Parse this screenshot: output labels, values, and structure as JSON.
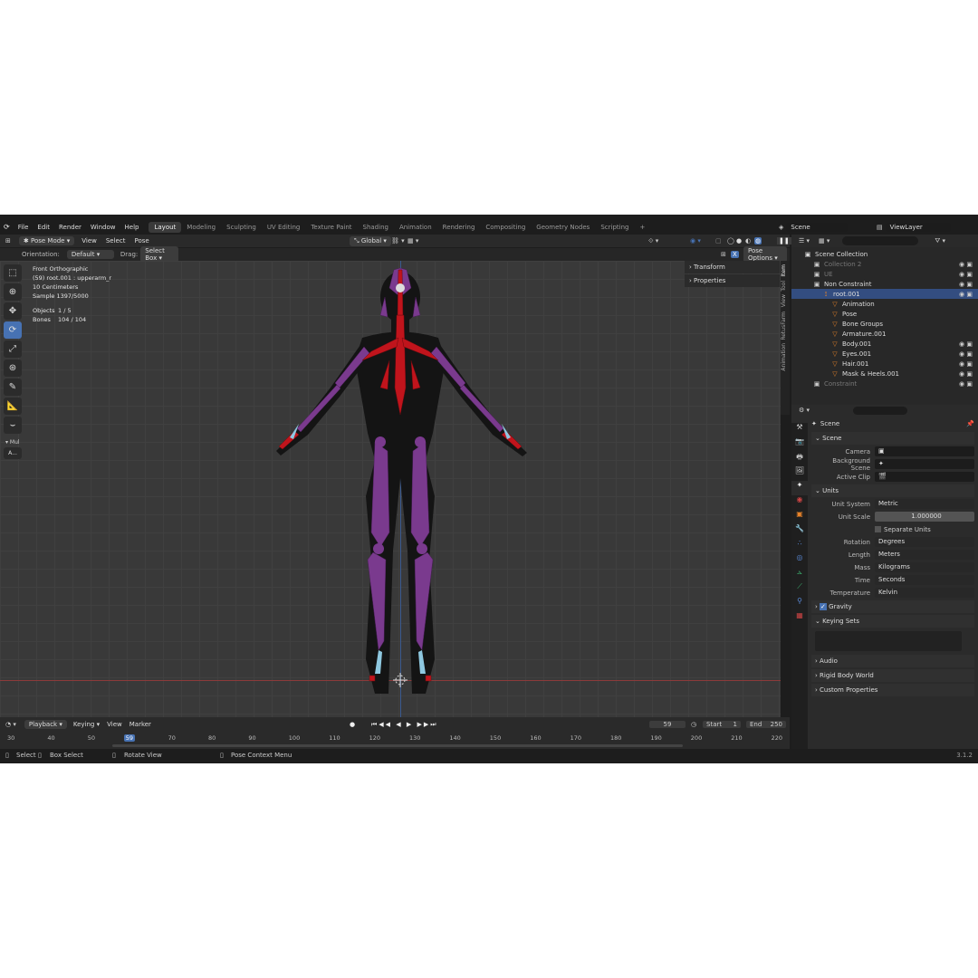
{
  "topbar": {
    "menu": [
      "File",
      "Edit",
      "Render",
      "Window",
      "Help"
    ],
    "workspaces": [
      "Layout",
      "Modeling",
      "Sculpting",
      "UV Editing",
      "Texture Paint",
      "Shading",
      "Animation",
      "Rendering",
      "Compositing",
      "Geometry Nodes",
      "Scripting"
    ],
    "active_workspace": "Layout",
    "scene": "Scene",
    "view_layer": "ViewLayer"
  },
  "viewport_header": {
    "mode": "Pose Mode",
    "menu": [
      "View",
      "Select",
      "Pose"
    ],
    "transform_orientation": "Global"
  },
  "tool_settings": {
    "orientation_label": "Orientation:",
    "orientation": "Default",
    "drag_label": "Drag:",
    "drag": "Select Box",
    "pose_options": "Pose Options"
  },
  "overlay": {
    "view": "Front Orthographic",
    "object": "(59) root.001 : upperarm_r",
    "scale": "10 Centimeters",
    "sample": "Sample 1397/5000",
    "objects_label": "Objects",
    "objects": "1 / 5",
    "bones_label": "Bones",
    "bones": "104 / 104"
  },
  "npanel": {
    "sections": [
      "Transform",
      "Properties"
    ],
    "tabs": [
      "Item",
      "Tool",
      "View",
      "RetusFarm",
      "Animation"
    ]
  },
  "toolbar_extra": "Mul",
  "outliner": {
    "root": "Scene Collection",
    "rows": [
      {
        "name": "Collection 2",
        "indent": 1,
        "dim": true
      },
      {
        "name": "UE",
        "indent": 1,
        "dim": true
      },
      {
        "name": "Non Constraint",
        "indent": 1
      },
      {
        "name": "root.001",
        "indent": 2,
        "selected": true
      },
      {
        "name": "Animation",
        "indent": 3
      },
      {
        "name": "Pose",
        "indent": 3
      },
      {
        "name": "Bone Groups",
        "indent": 3
      },
      {
        "name": "Armature.001",
        "indent": 3
      },
      {
        "name": "Body.001",
        "indent": 3
      },
      {
        "name": "Eyes.001",
        "indent": 3
      },
      {
        "name": "Hair.001",
        "indent": 3
      },
      {
        "name": "Mask & Heels.001",
        "indent": 3
      },
      {
        "name": "Constraint",
        "indent": 1,
        "dim": true
      }
    ]
  },
  "properties": {
    "title": "Scene",
    "scene_panel": "Scene",
    "camera_label": "Camera",
    "background_label": "Background Scene",
    "clip_label": "Active Clip",
    "units_panel": "Units",
    "units": [
      {
        "label": "Unit System",
        "value": "Metric"
      },
      {
        "label": "Unit Scale",
        "value": "1.000000"
      }
    ],
    "separate_units": "Separate Units",
    "units2": [
      {
        "label": "Rotation",
        "value": "Degrees"
      },
      {
        "label": "Length",
        "value": "Meters"
      },
      {
        "label": "Mass",
        "value": "Kilograms"
      },
      {
        "label": "Time",
        "value": "Seconds"
      },
      {
        "label": "Temperature",
        "value": "Kelvin"
      }
    ],
    "gravity": "Gravity",
    "keying_sets": "Keying Sets",
    "collapsed": [
      "Audio",
      "Rigid Body World",
      "Custom Properties"
    ]
  },
  "timeline": {
    "menu": [
      "Playback",
      "Keying",
      "View",
      "Marker"
    ],
    "current_frame": "59",
    "start_label": "Start",
    "start": "1",
    "end_label": "End",
    "end": "250",
    "ticks": [
      "30",
      "40",
      "50",
      "59",
      "70",
      "80",
      "90",
      "100",
      "110",
      "120",
      "130",
      "140",
      "150",
      "160",
      "170",
      "180",
      "190",
      "200",
      "210",
      "220"
    ]
  },
  "statusbar": {
    "items": [
      "Select",
      "Box Select",
      "Rotate View",
      "Pose Context Menu"
    ],
    "version": "3.1.2"
  },
  "colors": {
    "accent": "#4772b3",
    "bone": "#7a3a8e",
    "bone_selected": "#c0141c",
    "bone_tip": "#8ec8e0"
  }
}
